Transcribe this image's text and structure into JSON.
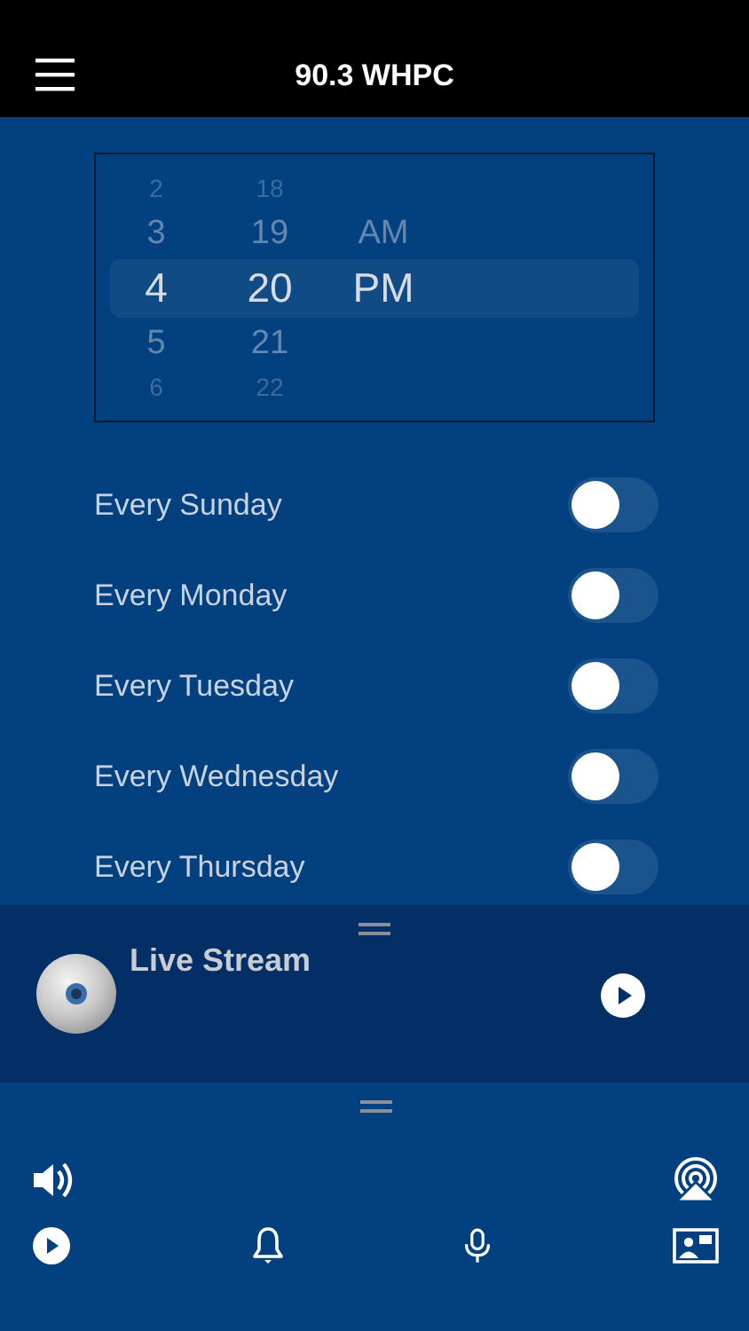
{
  "header": {
    "title": "90.3 WHPC"
  },
  "time_picker": {
    "columns": [
      {
        "items": [
          {
            "label": "2",
            "selected": false
          },
          {
            "label": "3",
            "selected": false
          },
          {
            "label": "4",
            "selected": true
          },
          {
            "label": "5",
            "selected": false
          },
          {
            "label": "6",
            "selected": false
          }
        ]
      },
      {
        "items": [
          {
            "label": "18",
            "selected": false
          },
          {
            "label": "19",
            "selected": false
          },
          {
            "label": "20",
            "selected": true
          },
          {
            "label": "21",
            "selected": false
          },
          {
            "label": "22",
            "selected": false
          }
        ]
      },
      {
        "items": [
          {
            "label": "AM",
            "selected": false
          },
          {
            "label": "PM",
            "selected": true
          }
        ]
      }
    ]
  },
  "alarms": [
    {
      "label": "Every Sunday",
      "on": false
    },
    {
      "label": "Every Monday",
      "on": false
    },
    {
      "label": "Every Tuesday",
      "on": false
    },
    {
      "label": "Every Wednesday",
      "on": false
    },
    {
      "label": "Every Thursday",
      "on": false
    }
  ],
  "player": {
    "title": "Live Stream"
  }
}
